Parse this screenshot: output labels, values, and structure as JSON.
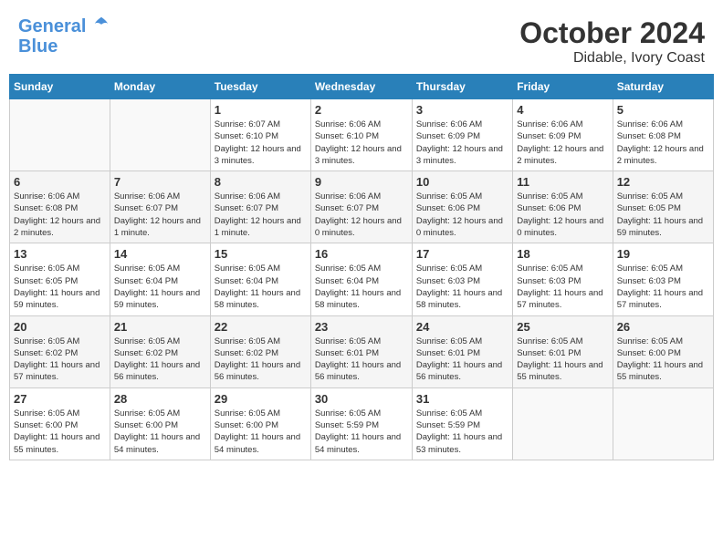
{
  "header": {
    "logo_line1": "General",
    "logo_line2": "Blue",
    "month": "October 2024",
    "location": "Didable, Ivory Coast"
  },
  "weekdays": [
    "Sunday",
    "Monday",
    "Tuesday",
    "Wednesday",
    "Thursday",
    "Friday",
    "Saturday"
  ],
  "weeks": [
    [
      {
        "day": "",
        "info": ""
      },
      {
        "day": "",
        "info": ""
      },
      {
        "day": "1",
        "info": "Sunrise: 6:07 AM\nSunset: 6:10 PM\nDaylight: 12 hours and 3 minutes."
      },
      {
        "day": "2",
        "info": "Sunrise: 6:06 AM\nSunset: 6:10 PM\nDaylight: 12 hours and 3 minutes."
      },
      {
        "day": "3",
        "info": "Sunrise: 6:06 AM\nSunset: 6:09 PM\nDaylight: 12 hours and 3 minutes."
      },
      {
        "day": "4",
        "info": "Sunrise: 6:06 AM\nSunset: 6:09 PM\nDaylight: 12 hours and 2 minutes."
      },
      {
        "day": "5",
        "info": "Sunrise: 6:06 AM\nSunset: 6:08 PM\nDaylight: 12 hours and 2 minutes."
      }
    ],
    [
      {
        "day": "6",
        "info": "Sunrise: 6:06 AM\nSunset: 6:08 PM\nDaylight: 12 hours and 2 minutes."
      },
      {
        "day": "7",
        "info": "Sunrise: 6:06 AM\nSunset: 6:07 PM\nDaylight: 12 hours and 1 minute."
      },
      {
        "day": "8",
        "info": "Sunrise: 6:06 AM\nSunset: 6:07 PM\nDaylight: 12 hours and 1 minute."
      },
      {
        "day": "9",
        "info": "Sunrise: 6:06 AM\nSunset: 6:07 PM\nDaylight: 12 hours and 0 minutes."
      },
      {
        "day": "10",
        "info": "Sunrise: 6:05 AM\nSunset: 6:06 PM\nDaylight: 12 hours and 0 minutes."
      },
      {
        "day": "11",
        "info": "Sunrise: 6:05 AM\nSunset: 6:06 PM\nDaylight: 12 hours and 0 minutes."
      },
      {
        "day": "12",
        "info": "Sunrise: 6:05 AM\nSunset: 6:05 PM\nDaylight: 11 hours and 59 minutes."
      }
    ],
    [
      {
        "day": "13",
        "info": "Sunrise: 6:05 AM\nSunset: 6:05 PM\nDaylight: 11 hours and 59 minutes."
      },
      {
        "day": "14",
        "info": "Sunrise: 6:05 AM\nSunset: 6:04 PM\nDaylight: 11 hours and 59 minutes."
      },
      {
        "day": "15",
        "info": "Sunrise: 6:05 AM\nSunset: 6:04 PM\nDaylight: 11 hours and 58 minutes."
      },
      {
        "day": "16",
        "info": "Sunrise: 6:05 AM\nSunset: 6:04 PM\nDaylight: 11 hours and 58 minutes."
      },
      {
        "day": "17",
        "info": "Sunrise: 6:05 AM\nSunset: 6:03 PM\nDaylight: 11 hours and 58 minutes."
      },
      {
        "day": "18",
        "info": "Sunrise: 6:05 AM\nSunset: 6:03 PM\nDaylight: 11 hours and 57 minutes."
      },
      {
        "day": "19",
        "info": "Sunrise: 6:05 AM\nSunset: 6:03 PM\nDaylight: 11 hours and 57 minutes."
      }
    ],
    [
      {
        "day": "20",
        "info": "Sunrise: 6:05 AM\nSunset: 6:02 PM\nDaylight: 11 hours and 57 minutes."
      },
      {
        "day": "21",
        "info": "Sunrise: 6:05 AM\nSunset: 6:02 PM\nDaylight: 11 hours and 56 minutes."
      },
      {
        "day": "22",
        "info": "Sunrise: 6:05 AM\nSunset: 6:02 PM\nDaylight: 11 hours and 56 minutes."
      },
      {
        "day": "23",
        "info": "Sunrise: 6:05 AM\nSunset: 6:01 PM\nDaylight: 11 hours and 56 minutes."
      },
      {
        "day": "24",
        "info": "Sunrise: 6:05 AM\nSunset: 6:01 PM\nDaylight: 11 hours and 56 minutes."
      },
      {
        "day": "25",
        "info": "Sunrise: 6:05 AM\nSunset: 6:01 PM\nDaylight: 11 hours and 55 minutes."
      },
      {
        "day": "26",
        "info": "Sunrise: 6:05 AM\nSunset: 6:00 PM\nDaylight: 11 hours and 55 minutes."
      }
    ],
    [
      {
        "day": "27",
        "info": "Sunrise: 6:05 AM\nSunset: 6:00 PM\nDaylight: 11 hours and 55 minutes."
      },
      {
        "day": "28",
        "info": "Sunrise: 6:05 AM\nSunset: 6:00 PM\nDaylight: 11 hours and 54 minutes."
      },
      {
        "day": "29",
        "info": "Sunrise: 6:05 AM\nSunset: 6:00 PM\nDaylight: 11 hours and 54 minutes."
      },
      {
        "day": "30",
        "info": "Sunrise: 6:05 AM\nSunset: 5:59 PM\nDaylight: 11 hours and 54 minutes."
      },
      {
        "day": "31",
        "info": "Sunrise: 6:05 AM\nSunset: 5:59 PM\nDaylight: 11 hours and 53 minutes."
      },
      {
        "day": "",
        "info": ""
      },
      {
        "day": "",
        "info": ""
      }
    ]
  ]
}
